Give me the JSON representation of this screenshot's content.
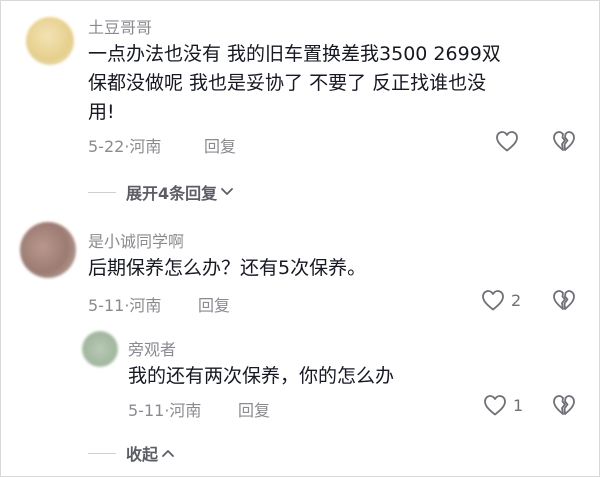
{
  "comments": [
    {
      "username": "土豆哥哥",
      "content": "一点办法也没有 我的旧车置换差我3500 2699双保都没做呢 我也是妥协了 不要了 反正找谁也没用!",
      "date": "5-22",
      "location": "河南",
      "reply_label": "回复",
      "like_count": ""
    },
    {
      "username": "是小诚同学啊",
      "content": "后期保养怎么办？还有5次保养。",
      "date": "5-11",
      "location": "河南",
      "reply_label": "回复",
      "like_count": "2"
    }
  ],
  "expand_replies_label": "展开4条回复",
  "reply": {
    "username": "旁观者",
    "content": "我的还有两次保养，你的怎么办",
    "date": "5-11",
    "location": "河南",
    "reply_label": "回复",
    "like_count": "1"
  },
  "collapse_label": "收起",
  "separator": "·",
  "colors": {
    "text": "#161823",
    "muted": "#8a8b91",
    "icon": "#6f7078"
  },
  "icons": [
    "heart-outline-icon",
    "broken-heart-icon",
    "chevron-down-icon",
    "chevron-up-icon"
  ]
}
